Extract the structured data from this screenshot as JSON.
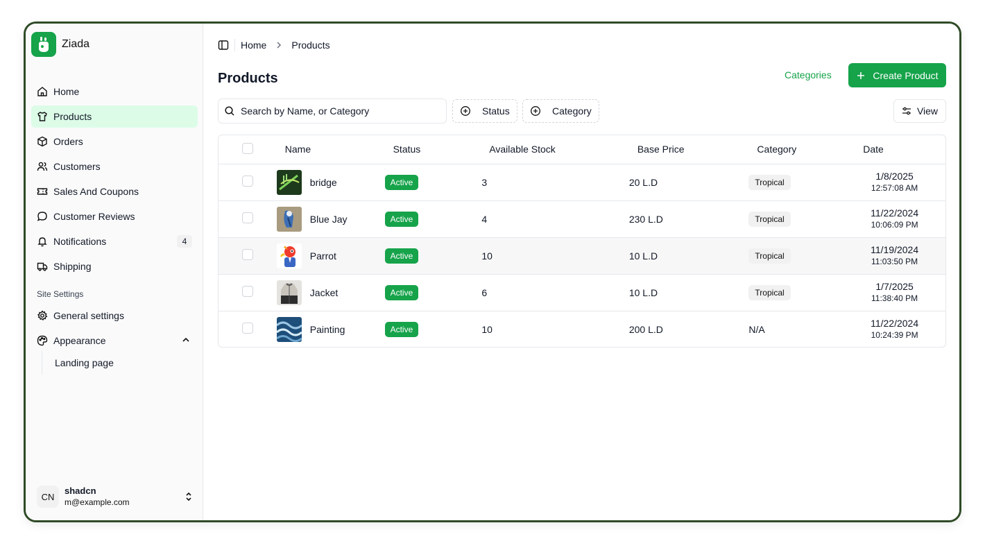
{
  "brand": {
    "name": "Ziada"
  },
  "sidebar": {
    "items": [
      {
        "label": "Home",
        "icon": "home-icon"
      },
      {
        "label": "Products",
        "icon": "shirt-icon",
        "active": true
      },
      {
        "label": "Orders",
        "icon": "package-icon"
      },
      {
        "label": "Customers",
        "icon": "users-icon"
      },
      {
        "label": "Sales And Coupons",
        "icon": "ticket-icon"
      },
      {
        "label": "Customer Reviews",
        "icon": "message-icon"
      },
      {
        "label": "Notifications",
        "icon": "bell-icon",
        "count": "4"
      },
      {
        "label": "Shipping",
        "icon": "truck-icon"
      }
    ],
    "section_label": "Site Settings",
    "settings_items": [
      {
        "label": "General settings",
        "icon": "gear-icon"
      },
      {
        "label": "Appearance",
        "icon": "palette-icon"
      }
    ],
    "sub_items": [
      {
        "label": "Landing page"
      }
    ],
    "user": {
      "initials": "CN",
      "name": "shadcn",
      "email": "m@example.com"
    }
  },
  "breadcrumb": [
    "Home",
    "Products"
  ],
  "page": {
    "title": "Products",
    "categories_label": "Categories",
    "create_label": "Create Product",
    "search_placeholder": "Search by Name, or Category",
    "filters": [
      "Status",
      "Category"
    ],
    "view_label": "View"
  },
  "table": {
    "columns": [
      "Name",
      "Status",
      "Available Stock",
      "Base Price",
      "Category",
      "Date"
    ],
    "rows": [
      {
        "name": "bridge",
        "status": "Active",
        "stock": "3",
        "price": "20 L.D",
        "category": "Tropical",
        "date": "1/8/2025",
        "time": "12:57:08 AM",
        "thumb": "bridge"
      },
      {
        "name": "Blue Jay",
        "status": "Active",
        "stock": "4",
        "price": "230 L.D",
        "category": "Tropical",
        "date": "11/22/2024",
        "time": "10:06:09 PM",
        "thumb": "bluejay"
      },
      {
        "name": "Parrot",
        "status": "Active",
        "stock": "10",
        "price": "10 L.D",
        "category": "Tropical",
        "date": "11/19/2024",
        "time": "11:03:50 PM",
        "thumb": "parrot"
      },
      {
        "name": "Jacket",
        "status": "Active",
        "stock": "6",
        "price": "10 L.D",
        "category": "Tropical",
        "date": "1/7/2025",
        "time": "11:38:40 PM",
        "thumb": "jacket"
      },
      {
        "name": "Painting",
        "status": "Active",
        "stock": "10",
        "price": "200 L.D",
        "category": "N/A",
        "date": "11/22/2024",
        "time": "10:24:39 PM",
        "thumb": "painting"
      }
    ]
  }
}
